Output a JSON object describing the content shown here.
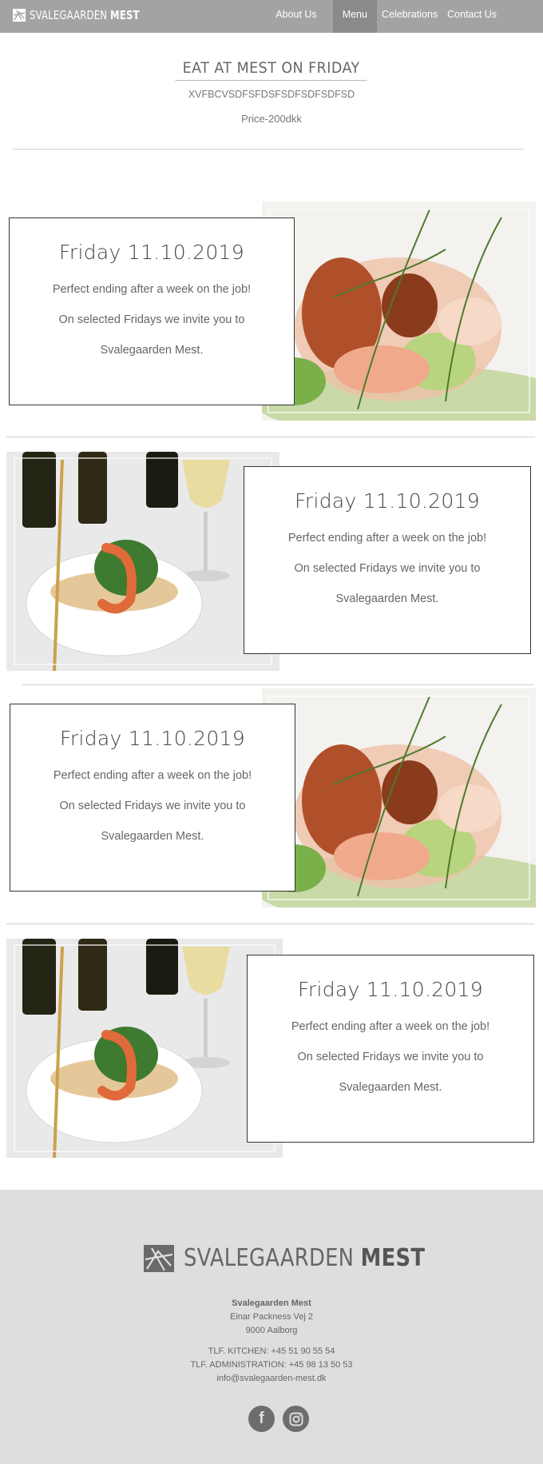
{
  "nav": {
    "brand_light": "SVALEGAARDEN",
    "brand_bold": "MEST",
    "links": [
      {
        "label": "About Us"
      },
      {
        "label": "Menu"
      },
      {
        "label": "Celebrations"
      },
      {
        "label": "Contact Us"
      }
    ],
    "active": "Menu"
  },
  "hero": {
    "title": "EAT AT MEST ON FRIDAY",
    "subtitle": "XVFBCVSDFSFDSFSDFSDFSDFSD",
    "price": "Price-200dkk"
  },
  "events": [
    {
      "date": "Friday 11.10.2019",
      "line1": "Perfect ending after a week on the job!",
      "line2": "On selected Fridays we invite you to",
      "line3": "Svalegaarden Mest.",
      "photo": "salad-photo"
    },
    {
      "date": "Friday 11.10.2019",
      "line1": "Perfect ending after a week on the job!",
      "line2": "On selected Fridays we invite you to",
      "line3": "Svalegaarden Mest.",
      "photo": "shrimp-bowl-photo"
    },
    {
      "date": "Friday 11.10.2019",
      "line1": "Perfect ending after a week on the job!",
      "line2": "On selected Fridays we invite you to",
      "line3": "Svalegaarden Mest.",
      "photo": "salad-photo"
    },
    {
      "date": "Friday 11.10.2019",
      "line1": "Perfect ending after a week on the job!",
      "line2": "On selected Fridays we invite you to",
      "line3": "Svalegaarden Mest.",
      "photo": "shrimp-bowl-photo"
    }
  ],
  "footer": {
    "logo_light": "SVALEGAARDEN",
    "logo_bold": "MEST",
    "name": "Svalegaarden Mest",
    "street": "Einar Packness Vej 2",
    "city": "9000 Aalborg",
    "kitchen": "TLF. KITCHEN: +45 51 90 55 54",
    "admin": "TLF. ADMINISTRATION: +45 98 13 50 53",
    "email": "info@svalegaarden-mest.dk",
    "social": [
      {
        "icon": "facebook-icon",
        "glyph": "f"
      },
      {
        "icon": "instagram-icon",
        "glyph": ""
      }
    ]
  },
  "colors": {
    "nav_bg": "#a3a3a3",
    "nav_active": "#8a8a8a",
    "footer_bg": "#dedede",
    "text": "#555555"
  }
}
